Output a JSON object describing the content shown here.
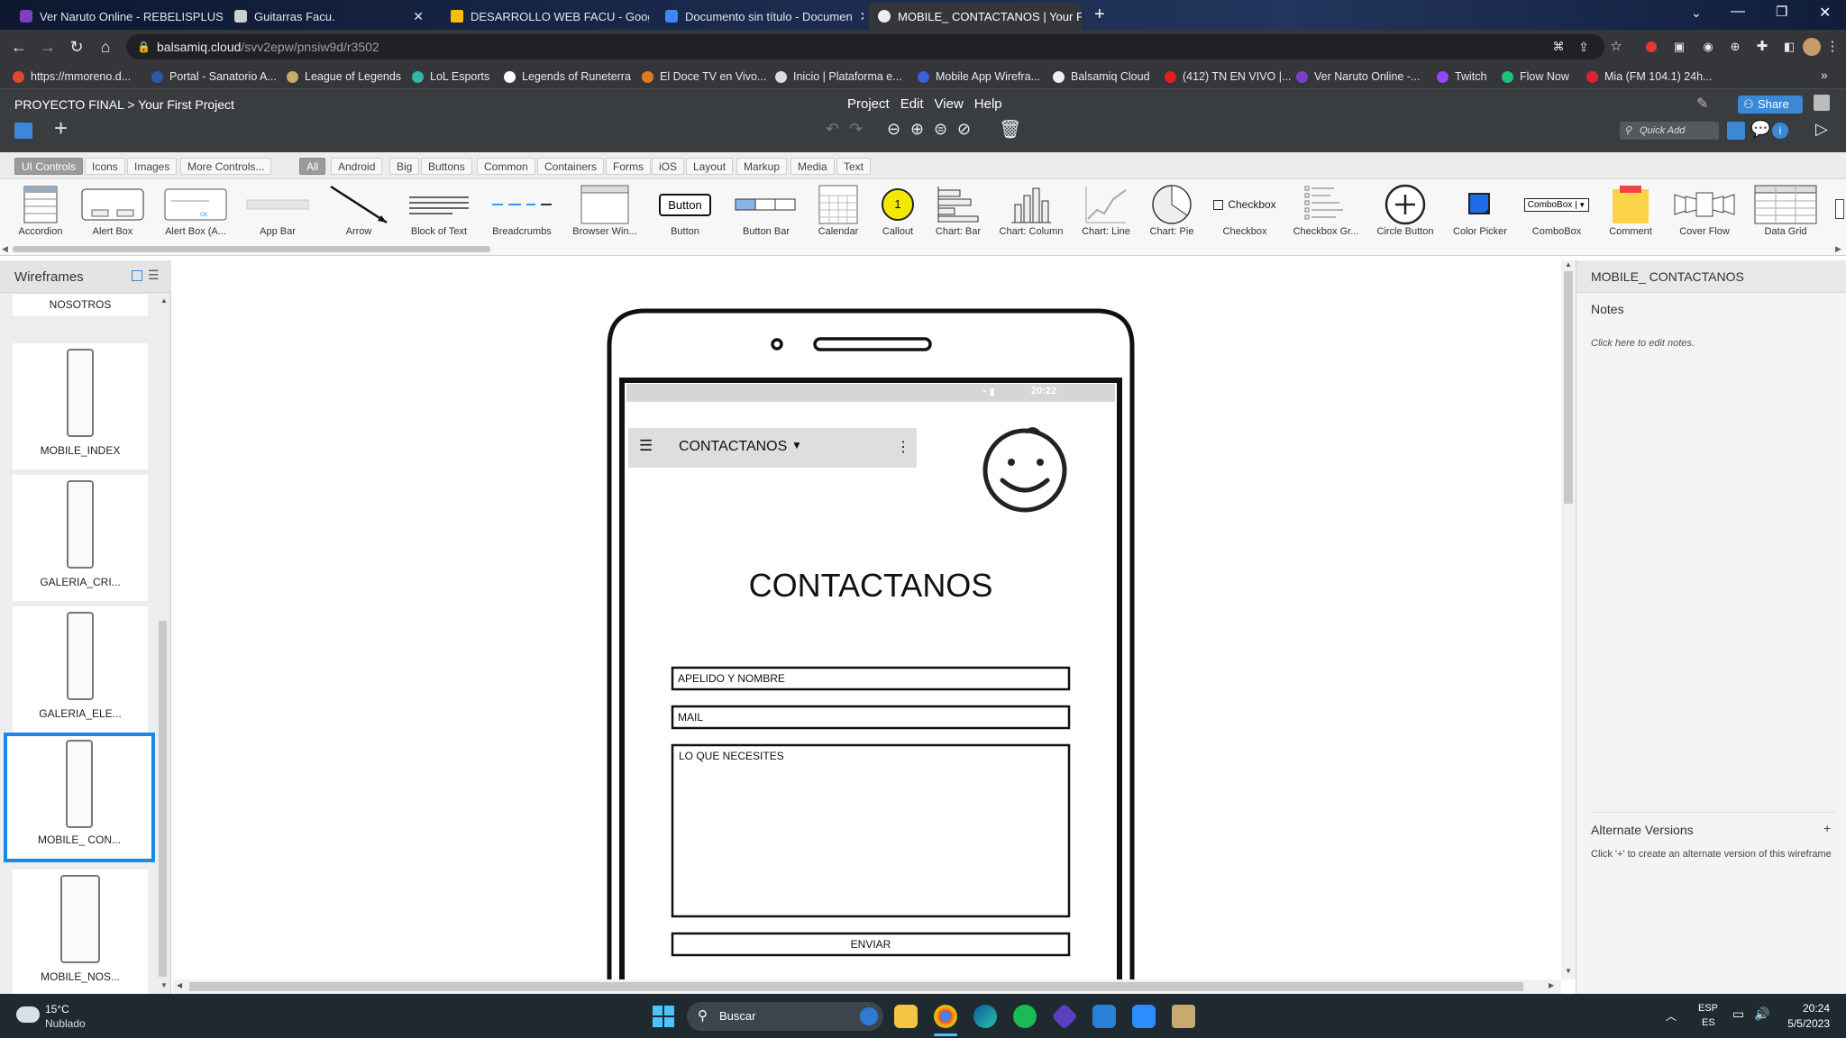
{
  "browser": {
    "tabs": [
      {
        "title": "Ver Naruto Online - REBELISPLUS",
        "color": "#7b3fc4",
        "active": false
      },
      {
        "title": "Guitarras Facu.",
        "color": "#5a5a5a",
        "active": false
      },
      {
        "title": "DESARROLLO WEB FACU - Goog",
        "color": "#fbbc04",
        "active": false
      },
      {
        "title": "Documento sin título - Documen",
        "color": "#4285f4",
        "active": false
      },
      {
        "title": "MOBILE_ CONTACTANOS | Your F",
        "color": "#eeeeee",
        "active": true
      }
    ],
    "url_host": "balsamiq.cloud",
    "url_path": "/svv2epw/pnsiw9d/r3502",
    "bookmarks": [
      {
        "label": "https://mmoreno.d...",
        "color": "#e04a2a"
      },
      {
        "label": "Portal - Sanatorio A...",
        "color": "#2b5aa8"
      },
      {
        "label": "League of Legends",
        "color": "#c8aa6e"
      },
      {
        "label": "LoL Esports",
        "color": "#2fb8a8"
      },
      {
        "label": "Legends of Runeterra",
        "color": "#ffffff"
      },
      {
        "label": "El Doce TV en Vivo...",
        "color": "#e07a20"
      },
      {
        "label": "Inicio | Plataforma e...",
        "color": "#dddddd"
      },
      {
        "label": "Mobile App Wirefra...",
        "color": "#3a62d6"
      },
      {
        "label": "Balsamiq Cloud",
        "color": "#f0f0f0"
      },
      {
        "label": "(412) TN EN VIVO |...",
        "color": "#e02020"
      },
      {
        "label": "Ver Naruto Online -...",
        "color": "#7b3fc4"
      },
      {
        "label": "Twitch",
        "color": "#9146ff"
      },
      {
        "label": "Flow Now",
        "color": "#19c37d"
      },
      {
        "label": "Mia (FM 104.1) 24h...",
        "color": "#e02030"
      }
    ]
  },
  "app": {
    "project": "PROYECTO FINAL",
    "separator": ">",
    "file": "Your First Project",
    "menu": [
      "Project",
      "Edit",
      "View",
      "Help"
    ],
    "share_label": "Share",
    "quick_add_placeholder": "Quick Add"
  },
  "filters": {
    "left": [
      "UI Controls",
      "Icons",
      "Images",
      "More Controls..."
    ],
    "categories": [
      "All",
      "Android",
      "Big",
      "Buttons",
      "Common",
      "Containers",
      "Forms",
      "iOS",
      "Layout",
      "Markup",
      "Media",
      "Text"
    ],
    "selected_left": "UI Controls",
    "selected_category": "All"
  },
  "library": [
    {
      "label": "Accordion",
      "icon": "accordion"
    },
    {
      "label": "Alert Box",
      "icon": "alert-box"
    },
    {
      "label": "Alert Box (A...",
      "icon": "alert-box-android"
    },
    {
      "label": "App Bar",
      "icon": "app-bar"
    },
    {
      "label": "Arrow",
      "icon": "arrow"
    },
    {
      "label": "Block of Text",
      "icon": "block-of-text"
    },
    {
      "label": "Breadcrumbs",
      "icon": "breadcrumbs"
    },
    {
      "label": "Browser Win...",
      "icon": "browser-window"
    },
    {
      "label": "Button",
      "icon": "button",
      "text": "Button"
    },
    {
      "label": "Button Bar",
      "icon": "button-bar"
    },
    {
      "label": "Calendar",
      "icon": "calendar"
    },
    {
      "label": "Callout",
      "icon": "callout",
      "text": "1"
    },
    {
      "label": "Chart: Bar",
      "icon": "chart-bar"
    },
    {
      "label": "Chart: Column",
      "icon": "chart-column"
    },
    {
      "label": "Chart: Line",
      "icon": "chart-line"
    },
    {
      "label": "Chart: Pie",
      "icon": "chart-pie"
    },
    {
      "label": "Checkbox",
      "icon": "checkbox",
      "text": "Checkbox"
    },
    {
      "label": "Checkbox Gr...",
      "icon": "checkbox-group"
    },
    {
      "label": "Circle Button",
      "icon": "circle-button"
    },
    {
      "label": "Color Picker",
      "icon": "color-picker"
    },
    {
      "label": "ComboBox",
      "icon": "combobox",
      "text": "ComboBox"
    },
    {
      "label": "Comment",
      "icon": "comment"
    },
    {
      "label": "Cover Flow",
      "icon": "cover-flow"
    },
    {
      "label": "Data Grid",
      "icon": "data-grid"
    }
  ],
  "wireframes_panel": {
    "title": "Wireframes",
    "items": [
      {
        "label": "NOSOTROS",
        "selected": false
      },
      {
        "label": "MOBILE_INDEX",
        "selected": false
      },
      {
        "label": "GALERIA_CRI...",
        "selected": false
      },
      {
        "label": "GALERIA_ELE...",
        "selected": false
      },
      {
        "label": "MOBILE_ CON...",
        "selected": true
      },
      {
        "label": "MOBILE_NOS...",
        "selected": false
      }
    ]
  },
  "mockup": {
    "status_time": "20:22",
    "appbar_title": "CONTACTANOS",
    "heading": "CONTACTANOS",
    "field_name": "APELIDO Y NOMBRE",
    "field_mail": "MAIL",
    "field_message": "LO QUE NECESITES",
    "submit": "ENVIAR"
  },
  "right_panel": {
    "title": "MOBILE_ CONTACTANOS",
    "notes_label": "Notes",
    "notes_placeholder": "Click here to edit notes.",
    "alt_title": "Alternate Versions",
    "alt_plus": "+",
    "alt_help": "Click '+' to create an alternate version of this wireframe"
  },
  "taskbar": {
    "temp": "15°C",
    "weather": "Nublado",
    "search_placeholder": "Buscar",
    "lang": "ESP",
    "lang_region": "ES",
    "time": "20:24",
    "date": "5/5/2023"
  }
}
